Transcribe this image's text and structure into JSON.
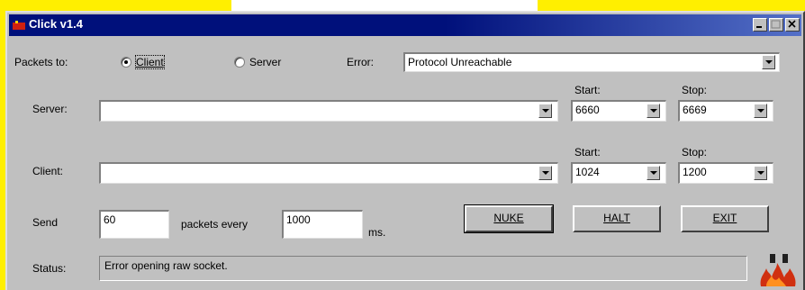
{
  "window": {
    "title": "Click v1.4"
  },
  "packets_to": {
    "label": "Packets to:",
    "options": [
      {
        "label": "Client",
        "selected": true
      },
      {
        "label": "Server",
        "selected": false
      }
    ]
  },
  "error": {
    "label": "Error:",
    "value": "Protocol Unreachable"
  },
  "server": {
    "label": "Server:",
    "value": "",
    "start_label": "Start:",
    "start_value": "6660",
    "stop_label": "Stop:",
    "stop_value": "6669"
  },
  "client": {
    "label": "Client:",
    "value": "",
    "start_label": "Start:",
    "start_value": "1024",
    "stop_label": "Stop:",
    "stop_value": "1200"
  },
  "send": {
    "label": "Send",
    "count": "60",
    "middle_label": "packets every",
    "interval": "1000",
    "unit_label": "ms."
  },
  "buttons": {
    "nuke": "NUKE",
    "halt": "HALT",
    "exit": "EXIT"
  },
  "status": {
    "label": "Status:",
    "value": "Error opening raw socket."
  },
  "colors": {
    "titlebar": "#00107b",
    "face": "#c0c0c0",
    "background": "#ffef00"
  }
}
